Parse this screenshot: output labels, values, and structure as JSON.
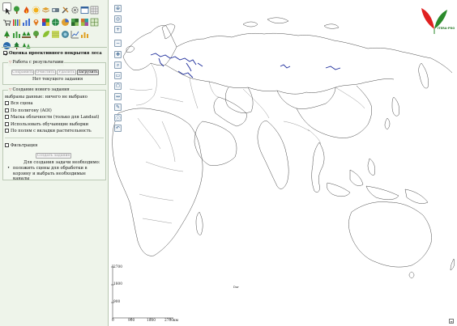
{
  "panel": {
    "assessment_title": "Оценка проективного покрытия леса",
    "results": {
      "legend": "Работа с результатами",
      "buttons": {
        "save": "Сохранить",
        "clear": "Очистить",
        "delete": "Удалить",
        "load": "Загрузить"
      },
      "status": "Нет текущего задания"
    },
    "new_task": {
      "legend": "Создание нового задания",
      "selected": "выбраны данные: ничего не выбрано",
      "options": [
        {
          "label": "Вся сцена",
          "checked": false
        },
        {
          "label": "По полигону (AOI)",
          "checked": false
        },
        {
          "label": "Маска облачности (только для Landsat)",
          "checked": false
        },
        {
          "label": "Использовать обучающие выборки",
          "checked": false
        },
        {
          "label": "По полям с вкладки растительность",
          "checked": false
        }
      ],
      "filter_label": "Фильтрация",
      "create_button": "Создать задание",
      "requirements_title": "Для создания задачи необходимо:",
      "requirements_item": "положить сцены для обработки в корзину и выбрать необходимые каналы"
    }
  },
  "map": {
    "scale_vertical": [
      "2700",
      "1800",
      "900"
    ],
    "scale_horizontal": [
      "0",
      "900",
      "1800",
      "2700км"
    ],
    "small_label": "Dar",
    "corner_label": "≡",
    "logo_text": "ITERA-PRO"
  },
  "colors": {
    "panel_bg": "#eef4ea",
    "accent": "#c66",
    "route": "#1a2a9a",
    "logo_red": "#e02020",
    "logo_green": "#2b8a2b"
  }
}
